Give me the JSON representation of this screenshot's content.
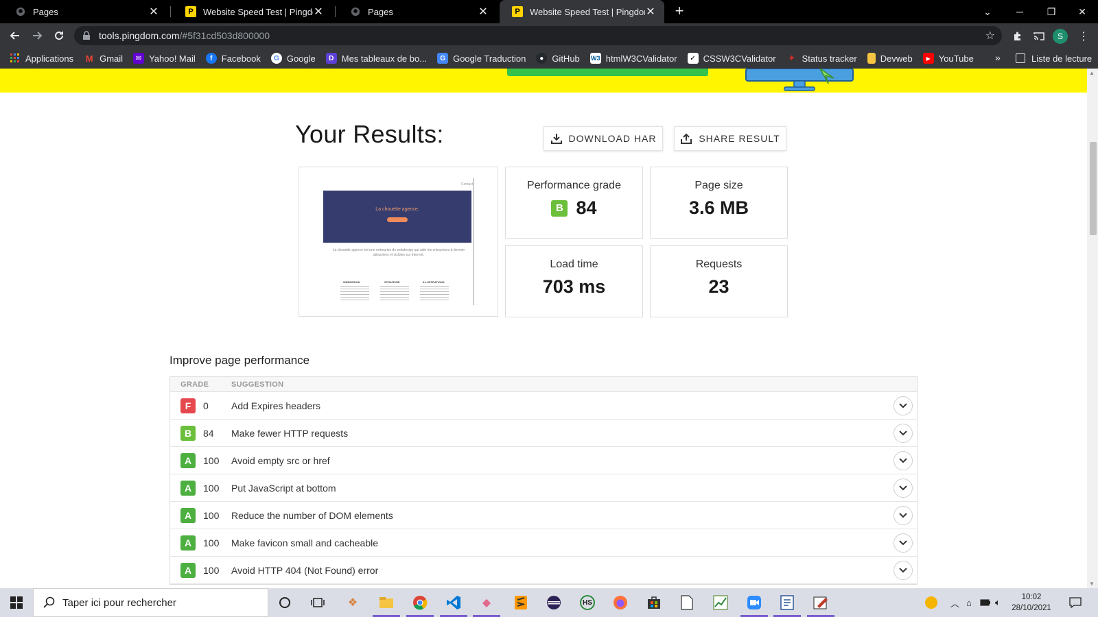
{
  "browser": {
    "tabs": [
      {
        "title": "Pages",
        "active": false
      },
      {
        "title": "Website Speed Test | Pingdom Tools",
        "active": false
      },
      {
        "title": "Pages",
        "active": false
      },
      {
        "title": "Website Speed Test | Pingdom Tools",
        "active": true
      }
    ],
    "url_host": "tools.pingdom.com",
    "url_rest": "/#5f31cd503d800000",
    "profile_initial": "S",
    "bookmarks": [
      {
        "label": "Applications",
        "icon": "apps-grid-icon"
      },
      {
        "label": "Gmail",
        "icon": "gmail-icon"
      },
      {
        "label": "Yahoo! Mail",
        "icon": "yahoo-mail-icon"
      },
      {
        "label": "Facebook",
        "icon": "facebook-icon"
      },
      {
        "label": "Google",
        "icon": "google-icon"
      },
      {
        "label": "Mes tableaux de bo...",
        "icon": "dashboard-icon"
      },
      {
        "label": "Google Traduction",
        "icon": "google-translate-icon"
      },
      {
        "label": "GitHub",
        "icon": "github-icon"
      },
      {
        "label": "htmlW3CValidator",
        "icon": "w3c-icon"
      },
      {
        "label": "CSSW3CValidator",
        "icon": "css-validator-icon"
      },
      {
        "label": "Status tracker",
        "icon": "maple-leaf-icon"
      },
      {
        "label": "Devweb",
        "icon": "folder-icon"
      },
      {
        "label": "YouTube",
        "icon": "youtube-icon"
      }
    ],
    "reading_list": "Liste de lecture"
  },
  "results": {
    "title": "Your Results:",
    "download_label": "DOWNLOAD HAR",
    "share_label": "SHARE RESULT",
    "thumbnail": {
      "hero_title": "La chouette agence.",
      "nav_link": "Contact",
      "intro_text": "La chouette agence est une entreprise de webdesign qui aide les entreprises à devenir attractives et visibles sur Internet.",
      "columns": [
        "WEBDESIGN",
        "STRATEGIE",
        "ILLUSTRATIONS"
      ]
    },
    "metrics": {
      "performance": {
        "label": "Performance grade",
        "grade": "B",
        "value": "84"
      },
      "page_size": {
        "label": "Page size",
        "value": "3.6 MB"
      },
      "load_time": {
        "label": "Load time",
        "value": "703 ms"
      },
      "requests": {
        "label": "Requests",
        "value": "23"
      }
    }
  },
  "improve": {
    "title": "Improve page performance",
    "headers": {
      "grade": "GRADE",
      "suggestion": "SUGGESTION"
    },
    "rows": [
      {
        "grade": "F",
        "score": "0",
        "suggestion": "Add Expires headers",
        "color": "#e5484d"
      },
      {
        "grade": "B",
        "score": "84",
        "suggestion": "Make fewer HTTP requests",
        "color": "#6bbf3b"
      },
      {
        "grade": "A",
        "score": "100",
        "suggestion": "Avoid empty src or href",
        "color": "#4caf3f"
      },
      {
        "grade": "A",
        "score": "100",
        "suggestion": "Put JavaScript at bottom",
        "color": "#4caf3f"
      },
      {
        "grade": "A",
        "score": "100",
        "suggestion": "Reduce the number of DOM elements",
        "color": "#4caf3f"
      },
      {
        "grade": "A",
        "score": "100",
        "suggestion": "Make favicon small and cacheable",
        "color": "#4caf3f"
      },
      {
        "grade": "A",
        "score": "100",
        "suggestion": "Avoid HTTP 404 (Not Found) error",
        "color": "#4caf3f"
      }
    ]
  },
  "taskbar": {
    "search_placeholder": "Taper ici pour rechercher",
    "time": "10:02",
    "date": "28/10/2021"
  },
  "colors": {
    "banner_yellow": "#fff500",
    "grade_a": "#4caf3f",
    "grade_b": "#6bbf3b",
    "grade_f": "#e5484d"
  }
}
